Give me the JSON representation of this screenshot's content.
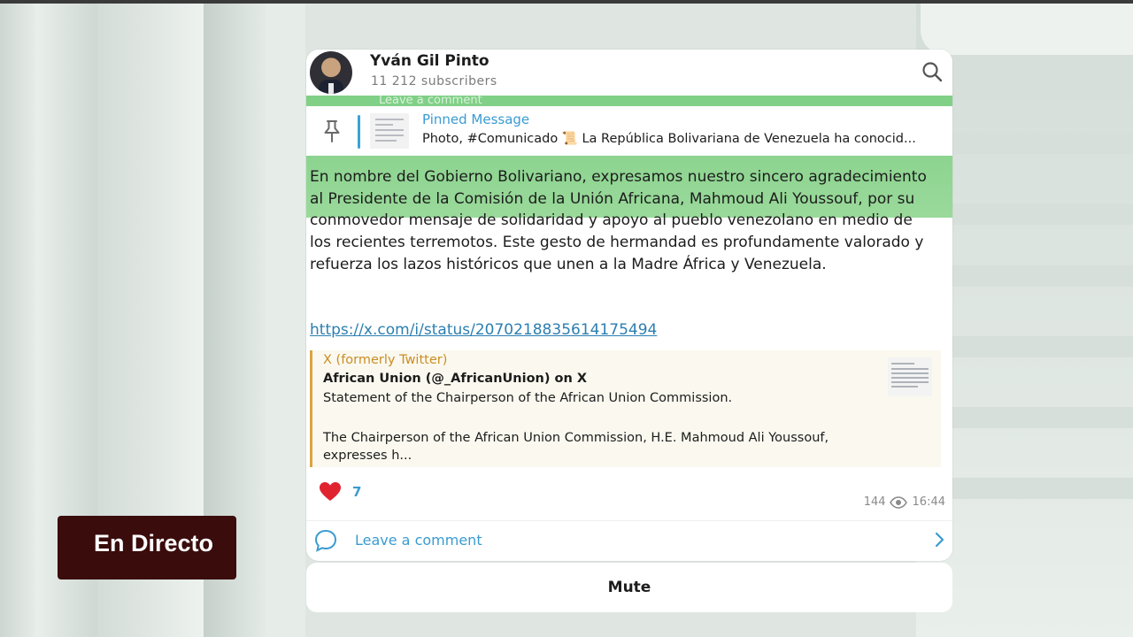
{
  "channel": {
    "name": "Yván Gil Pinto",
    "subscribers": "11 212 subscribers",
    "ghost_text": "Leave a comment"
  },
  "pinned": {
    "title": "Pinned Message",
    "text": "Photo, #Comunicado 📜 La República Bolivariana de Venezuela ha conocid..."
  },
  "post": {
    "body": "En nombre del Gobierno Bolivariano, expresamos nuestro sincero agradecimiento al Presidente de la Comisión de la Unión Africana, Mahmoud Ali Youssouf, por su conmovedor mensaje de solidaridad y apoyo al pueblo venezolano en medio de los recientes terremotos. Este gesto de hermandad es profundamente valorado y refuerza los lazos históricos que unen a la Madre África y Venezuela.",
    "link": "https://x.com/i/status/2070218835614175494",
    "preview": {
      "source": "X (formerly Twitter)",
      "title": "African Union (@_AfricanUnion) on X",
      "desc1": "Statement of the Chairperson of the African Union Commission.",
      "desc2": "The Chairperson of the African Union Commission, H.E. Mahmoud Ali Youssouf, expresses h..."
    },
    "reaction_count": "7",
    "views": "144",
    "time": "16:44"
  },
  "comment_label": "Leave a comment",
  "mute_label": "Mute",
  "overlay_label": "En Directo",
  "colors": {
    "accent": "#3a9bd1",
    "preview_bar": "#d9a441",
    "live_bg": "#3a0c0c",
    "chat_bg": "#8fd48f"
  },
  "icons": [
    "search-icon",
    "pin-icon",
    "heart-icon",
    "eye-icon",
    "comment-icon",
    "chevron-right-icon"
  ]
}
